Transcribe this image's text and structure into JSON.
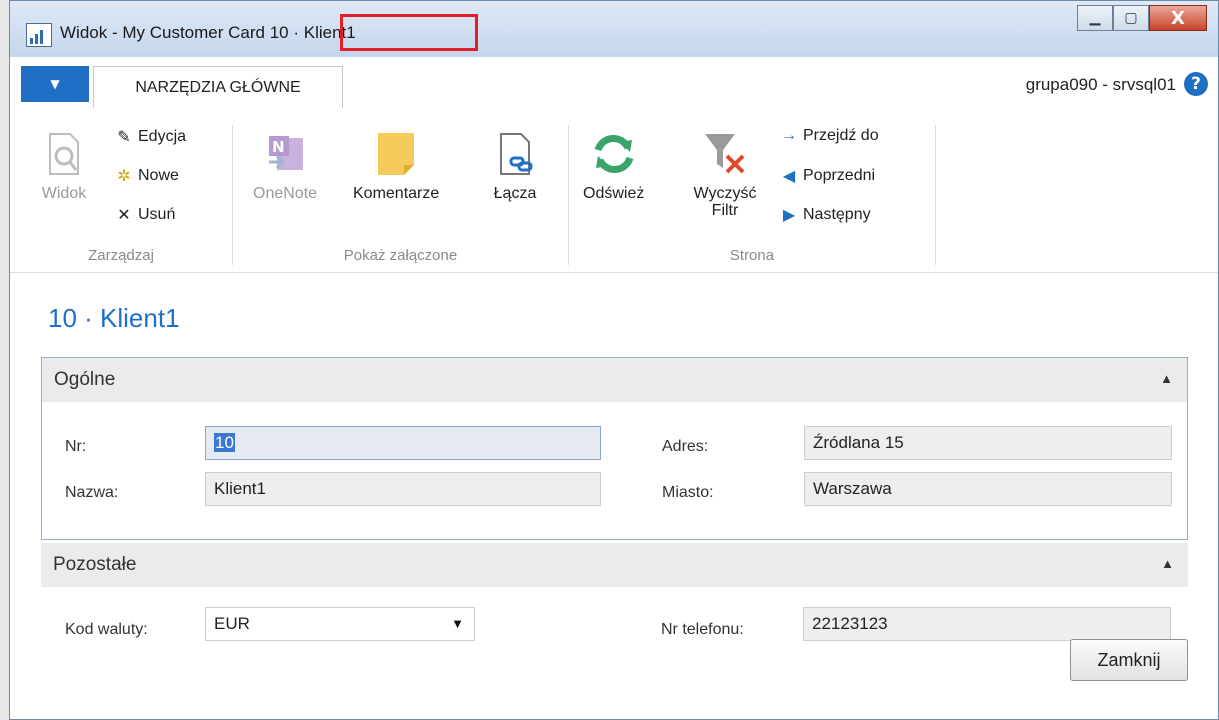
{
  "window": {
    "title_prefix": "Widok - My Customer Card",
    "title_highlight": "10 · Klient1",
    "minimize": "▁",
    "maximize": "▢",
    "close": "X"
  },
  "ribbon": {
    "file_tab": "▼",
    "home_tab": "NARZĘDZIA GŁÓWNE",
    "server": "grupa090 - srvsql01",
    "help": "?",
    "groups": {
      "manage": {
        "label": "Zarządzaj",
        "view": "Widok",
        "edit": "Edycja",
        "new": "Nowe",
        "delete": "Usuń"
      },
      "attachments": {
        "label": "Pokaż załączone",
        "onenote": "OneNote",
        "comments": "Komentarze",
        "links": "Łącza"
      },
      "page": {
        "label": "Strona",
        "refresh": "Odśwież",
        "clear_filter": "Wyczyść Filtr",
        "goto": "Przejdź do",
        "previous": "Poprzedni",
        "next": "Następny"
      }
    }
  },
  "page_title": "10 · Klient1",
  "general": {
    "header": "Ogólne",
    "no_label": "Nr:",
    "no_value": "10",
    "name_label": "Nazwa:",
    "name_value": "Klient1",
    "address_label": "Adres:",
    "address_value": "Źródlana 15",
    "city_label": "Miasto:",
    "city_value": "Warszawa"
  },
  "other": {
    "header": "Pozostałe",
    "currency_label": "Kod waluty:",
    "currency_value": "EUR",
    "phone_label": "Nr telefonu:",
    "phone_value": "22123123"
  },
  "close_button": "Zamknij"
}
